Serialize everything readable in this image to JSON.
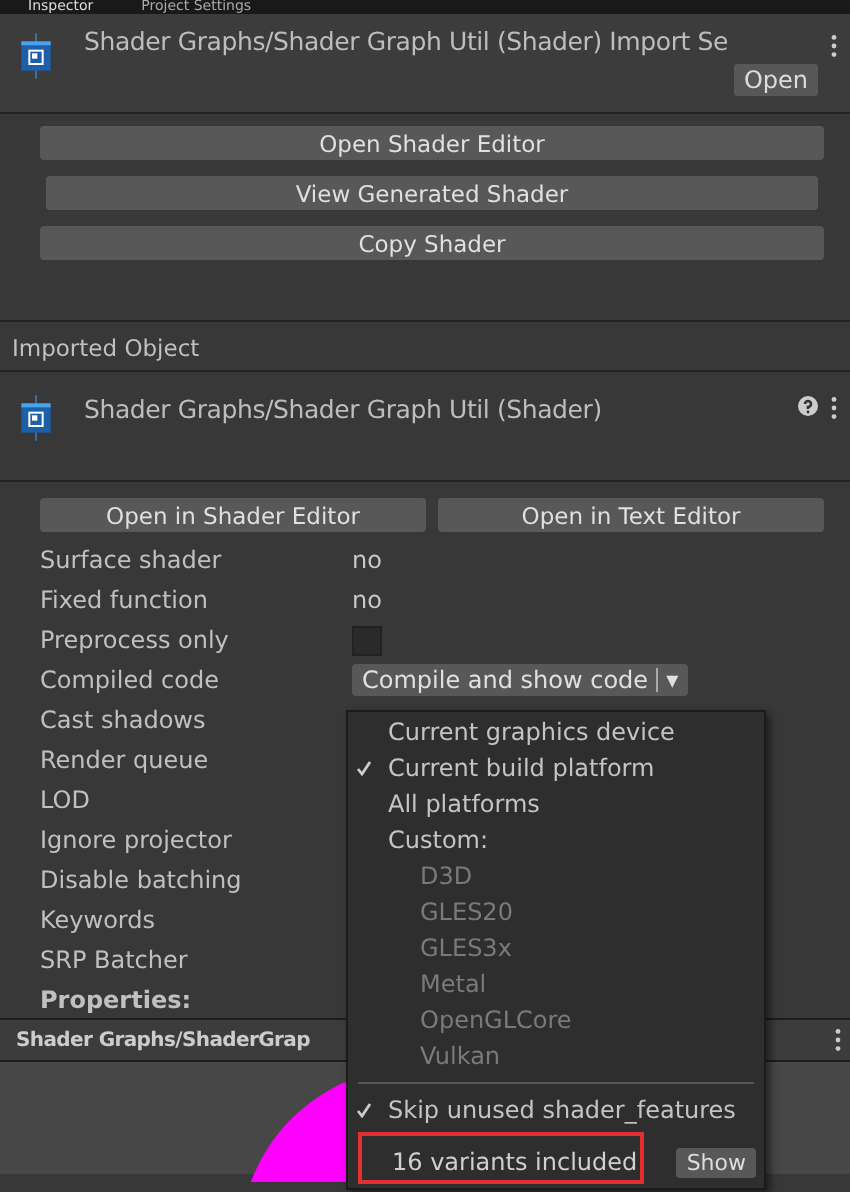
{
  "tabs": [
    {
      "label": "Inspector",
      "selected": true
    },
    {
      "label": "Project Settings",
      "selected": false
    }
  ],
  "header": {
    "title": "Shader Graphs/Shader Graph Util (Shader) Import Se",
    "open_button": "Open"
  },
  "actions": [
    "Open Shader Editor",
    "View Generated Shader",
    "Copy Shader"
  ],
  "imported_object": {
    "section": "Imported Object",
    "title": "Shader Graphs/Shader Graph Util (Shader)"
  },
  "editor_buttons": [
    "Open in Shader Editor",
    "Open in Text Editor"
  ],
  "properties": [
    {
      "kind": "text",
      "label": "Surface shader",
      "value": "no"
    },
    {
      "kind": "text",
      "label": "Fixed function",
      "value": "no"
    },
    {
      "kind": "checkbox",
      "label": "Preprocess only",
      "checked": false
    },
    {
      "kind": "dropdown",
      "label": "Compiled code",
      "value": "Compile and show code",
      "caret": "▾"
    },
    {
      "kind": "empty",
      "label": "Cast shadows"
    },
    {
      "kind": "empty",
      "label": "Render queue"
    },
    {
      "kind": "empty",
      "label": "LOD"
    },
    {
      "kind": "empty",
      "label": "Ignore projector"
    },
    {
      "kind": "empty",
      "label": "Disable batching"
    },
    {
      "kind": "empty",
      "label": "Keywords"
    },
    {
      "kind": "empty",
      "label": "SRP Batcher"
    },
    {
      "kind": "heading",
      "label": "Properties:"
    }
  ],
  "menu": {
    "items": [
      {
        "kind": "option",
        "label": "Current graphics device",
        "checked": false
      },
      {
        "kind": "option",
        "label": "Current build platform",
        "checked": true
      },
      {
        "kind": "option",
        "label": "All platforms",
        "checked": false
      },
      {
        "kind": "label",
        "label": "Custom:"
      },
      {
        "kind": "platform",
        "label": "D3D",
        "disabled": true
      },
      {
        "kind": "platform",
        "label": "GLES20",
        "disabled": true
      },
      {
        "kind": "platform",
        "label": "GLES3x",
        "disabled": true
      },
      {
        "kind": "platform",
        "label": "Metal",
        "disabled": true
      },
      {
        "kind": "platform",
        "label": "OpenGLCore",
        "disabled": true
      },
      {
        "kind": "platform",
        "label": "Vulkan",
        "disabled": true
      },
      {
        "kind": "separator"
      },
      {
        "kind": "option",
        "label": "Skip unused shader_features",
        "checked": true
      }
    ],
    "variants": "16 variants included",
    "show_button": "Show"
  },
  "preview": {
    "title": "Shader Graphs/ShaderGrap"
  }
}
